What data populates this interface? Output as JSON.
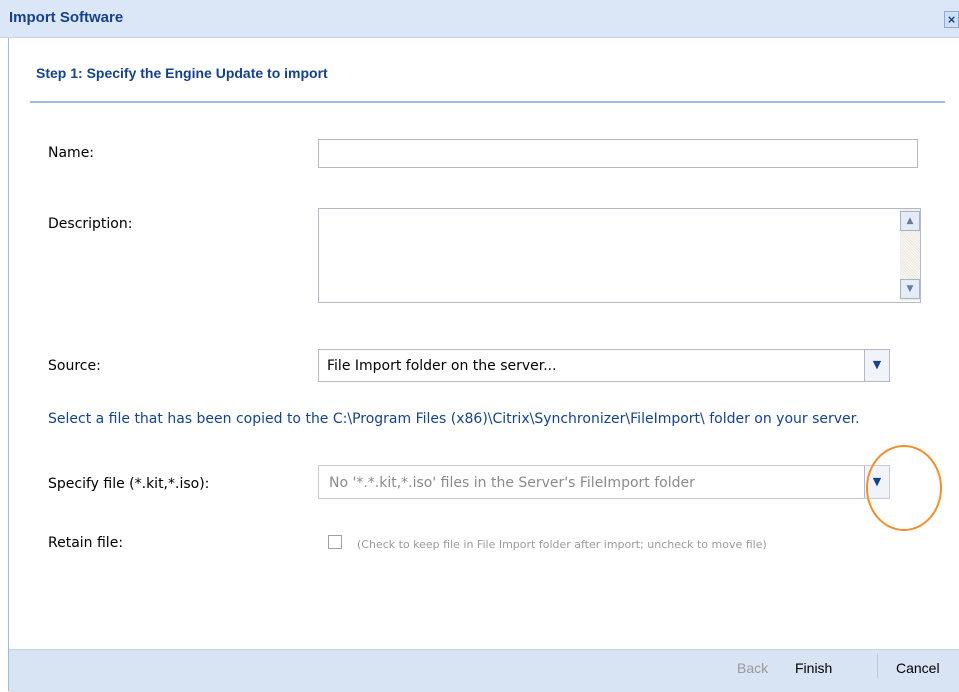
{
  "dialog": {
    "title": "Import Software",
    "close_icon": "close-icon",
    "step_header": "Step 1: Specify the Engine Update to import"
  },
  "form": {
    "name_label": "Name:",
    "name_value": "",
    "description_label": "Description:",
    "description_value": "",
    "source_label": "Source:",
    "source_value": "File Import folder on the server...",
    "info_text": "Select a file that has been copied to the C:\\Program Files (x86)\\Citrix\\Synchronizer\\FileImport\\ folder on your server.",
    "specify_file_label": "Specify file (*.kit,*.iso):",
    "specify_file_value": "No '*.*.kit,*.iso' files in the Server's FileImport folder",
    "retain_label": "Retain file:",
    "retain_checked": false,
    "retain_hint": "(Check to keep file in File Import folder after import; uncheck to move file)"
  },
  "footer": {
    "back_label": "Back",
    "finish_label": "Finish",
    "cancel_label": "Cancel"
  },
  "colors": {
    "accent": "#15428b",
    "highlight_circle": "#f0902c"
  }
}
